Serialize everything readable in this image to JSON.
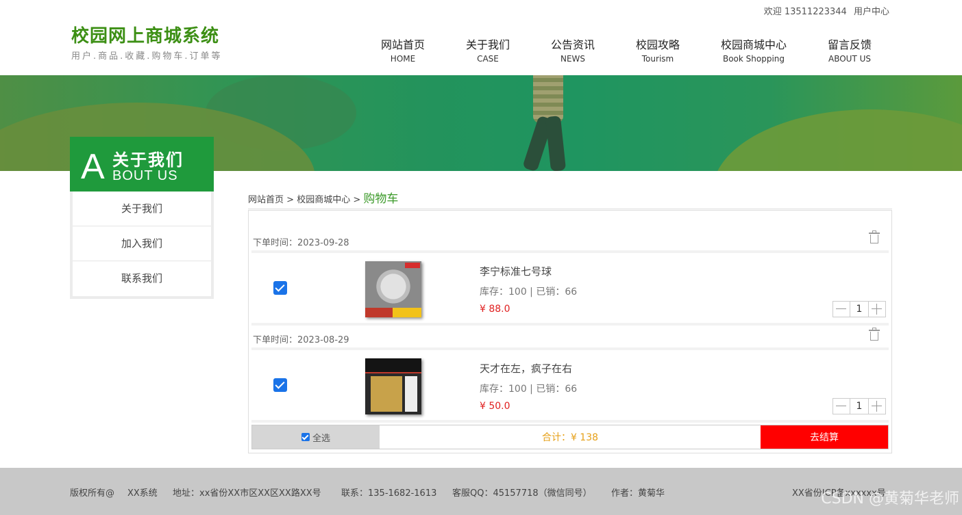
{
  "header": {
    "welcome": "欢迎 13511223344",
    "user_center": "用户中心",
    "site_title": "校园网上商城系统",
    "site_subtitle": "用户.商品.收藏.购物车.订单等",
    "nav": [
      {
        "cn": "网站首页",
        "en": "HOME"
      },
      {
        "cn": "关于我们",
        "en": "CASE"
      },
      {
        "cn": "公告资讯",
        "en": "NEWS"
      },
      {
        "cn": "校园攻略",
        "en": "Tourism"
      },
      {
        "cn": "校园商城中心",
        "en": "Book Shopping"
      },
      {
        "cn": "留言反馈",
        "en": "ABOUT US"
      }
    ]
  },
  "side": {
    "badge_letter": "A",
    "badge_cn": "关于我们",
    "badge_en": "BOUT   US",
    "menu": [
      "关于我们",
      "加入我们",
      "联系我们"
    ]
  },
  "breadcrumb": {
    "home": "网站首页",
    "sep": ">",
    "parent": "校园商城中心",
    "current": "购物车"
  },
  "cart": {
    "orders": [
      {
        "date": "下单时间：2023-09-28",
        "name": "李宁标准七号球",
        "stock": "库存：100 | 已销：66",
        "price": "¥ 88.0",
        "qty": "1",
        "checked": true
      },
      {
        "date": "下单时间：2023-08-29",
        "name": "天才在左，疯子在右",
        "stock": "库存：100 | 已销：66",
        "price": "¥ 50.0",
        "qty": "1",
        "checked": true
      }
    ],
    "select_all": "全选",
    "total": "合计：¥ 138",
    "checkout": "去结算"
  },
  "footer": {
    "copyright": "版权所有@",
    "system": "XX系统",
    "address": "地址：xx省份XX市区XX区XX路XX号",
    "phone": "联系：135-1682-1613",
    "qq": "客服QQ：45157718（微信同号）",
    "author": "作者：黄菊华",
    "icp": "XX省份ICP备xxxxxx号",
    "watermark": "CSDN @黄菊华老师"
  },
  "colors": {
    "brand_green": "#3c8f14",
    "badge_green": "#1f9a3c",
    "price_red": "#e02020",
    "checkout_red": "#ff0000",
    "total_orange": "#e6a018"
  }
}
